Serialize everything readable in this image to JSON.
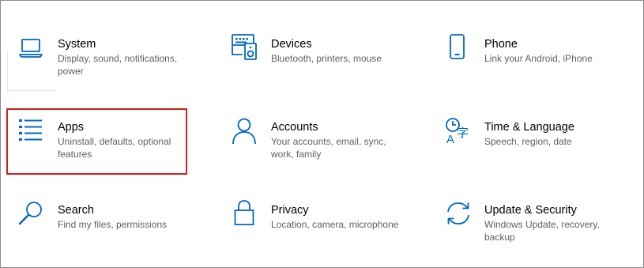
{
  "settings": {
    "accent": "#0067c0",
    "highlight_color": "#d41c1c",
    "tiles": [
      {
        "title": "System",
        "desc": "Display, sound, notifications, power",
        "icon": "laptop-icon"
      },
      {
        "title": "Devices",
        "desc": "Bluetooth, printers, mouse",
        "icon": "keyboard-speaker-icon"
      },
      {
        "title": "Phone",
        "desc": "Link your Android, iPhone",
        "icon": "phone-icon"
      },
      {
        "title": "Apps",
        "desc": "Uninstall, defaults, optional features",
        "icon": "apps-list-icon"
      },
      {
        "title": "Accounts",
        "desc": "Your accounts, email, sync, work, family",
        "icon": "person-icon"
      },
      {
        "title": "Time & Language",
        "desc": "Speech, region, date",
        "icon": "time-language-icon"
      },
      {
        "title": "Search",
        "desc": "Find my files, permissions",
        "icon": "search-icon"
      },
      {
        "title": "Privacy",
        "desc": "Location, camera, microphone",
        "icon": "lock-icon"
      },
      {
        "title": "Update & Security",
        "desc": "Windows Update, recovery, backup",
        "icon": "sync-arrows-icon"
      }
    ]
  }
}
